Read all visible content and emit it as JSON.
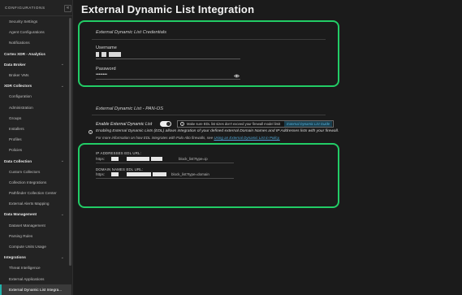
{
  "sidebar": {
    "header": "CONFIGURATIONS",
    "collapse_label": "«",
    "items": [
      {
        "label": "Security Settings",
        "kind": "item"
      },
      {
        "label": "Agent Configurations",
        "kind": "item"
      },
      {
        "label": "Notifications",
        "kind": "item"
      },
      {
        "label": "Cortex XDR - Analytics",
        "kind": "section"
      },
      {
        "label": "Data Broker",
        "kind": "section"
      },
      {
        "label": "Broker VMs",
        "kind": "item"
      },
      {
        "label": "XDR Collectors",
        "kind": "section"
      },
      {
        "label": "Configuration",
        "kind": "item"
      },
      {
        "label": "Administration",
        "kind": "item"
      },
      {
        "label": "Groups",
        "kind": "item"
      },
      {
        "label": "Installers",
        "kind": "item"
      },
      {
        "label": "Profiles",
        "kind": "item"
      },
      {
        "label": "Policies",
        "kind": "item"
      },
      {
        "label": "Data Collection",
        "kind": "section"
      },
      {
        "label": "Custom Collectors",
        "kind": "item"
      },
      {
        "label": "Collection Integrations",
        "kind": "item"
      },
      {
        "label": "Pathfinder Collection Center",
        "kind": "item"
      },
      {
        "label": "External Alerts Mapping",
        "kind": "item"
      },
      {
        "label": "Data Management",
        "kind": "section"
      },
      {
        "label": "Dataset Management",
        "kind": "item"
      },
      {
        "label": "Parsing Rules",
        "kind": "item"
      },
      {
        "label": "Compute Units Usage",
        "kind": "item"
      },
      {
        "label": "Integrations",
        "kind": "section"
      },
      {
        "label": "Threat Intelligence",
        "kind": "item"
      },
      {
        "label": "External Applications",
        "kind": "item"
      },
      {
        "label": "External Dynamic List Integra...",
        "kind": "active"
      }
    ]
  },
  "main": {
    "title": "External Dynamic List Integration",
    "credentials": {
      "section_title": "External Dynamic List Credentials",
      "username_label": "Username",
      "password_label": "Password",
      "password_value": "••••••••"
    },
    "pan_os": {
      "section_title": "External Dynamic List - PAN-OS",
      "enable_label": "Enable External Dynamic List",
      "toggle_on": true,
      "tip_text": "Make sure EDL list sizes don't exceed your firewall model limit",
      "tip_link": "External Dynamic List Guide",
      "description": "Enabling External Dynamic Lists (EDL) allows integration of your defined external Domain Names and IP Addresses lists with your firewall.",
      "more_info_prefix": "For more information on how EDL integrates with Palo Alto firewalls, see",
      "more_info_link": "Using an External Dynamic List in Policy."
    },
    "urls": {
      "ip_label": "IP ADDRESSES EDL URL:",
      "ip_prefix": "https:",
      "ip_suffix": "block_list?type=ip",
      "domain_label": "DOMAIN NAMES EDL URL:",
      "domain_prefix": "https:",
      "domain_suffix": "block_list?type=domain"
    }
  },
  "colors": {
    "highlight": "#22cc66",
    "accent": "#20b2aa",
    "link": "#4fa8d8"
  }
}
